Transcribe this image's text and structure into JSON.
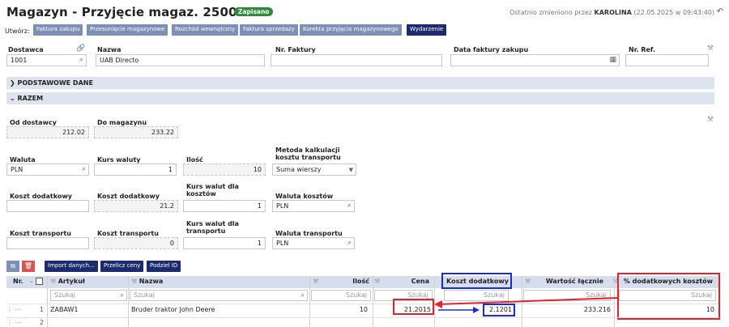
{
  "header": {
    "title": "Magazyn - Przyjęcie magaz. 2500018",
    "status_badge": "Zapisano",
    "last_changed_prefix": "Ostatnio zmieniono przez",
    "last_changed_user": "KAROLINA",
    "last_changed_time": "(22.05.2025 w 09:43:40)"
  },
  "create": {
    "label": "Utwórz:",
    "buttons": [
      "Faktura zakupu",
      "Przesunięcie magazynowe",
      "Rozchód wewnętrzny",
      "Faktura sprzedaży",
      "Korekta przyjęcia magazynowego",
      "Wydarzenie"
    ]
  },
  "top_fields": {
    "dostawca_label": "Dostawca",
    "dostawca_value": "1001",
    "nazwa_label": "Nazwa",
    "nazwa_value": "UAB Directo",
    "nr_faktury_label": "Nr. Faktury",
    "nr_faktury_value": "",
    "data_faktury_label": "Data faktury zakupu",
    "data_faktury_value": "",
    "nr_ref_label": "Nr. Ref.",
    "nr_ref_value": ""
  },
  "sections": {
    "basic": "PODSTAWOWE DANE",
    "total": "RAZEM"
  },
  "totals": {
    "od_dostawcy_label": "Od dostawcy",
    "od_dostawcy_value": "212.02",
    "do_magazynu_label": "Do magazynu",
    "do_magazynu_value": "233.22",
    "waluta_label": "Waluta",
    "waluta_value": "PLN",
    "kurs_waluty_label": "Kurs waluty",
    "kurs_waluty_value": "1",
    "ilosc_label": "Ilość",
    "ilosc_value": "10",
    "metoda_label_1": "Metoda kalkulacji",
    "metoda_label_2": "kosztu transportu",
    "metoda_value": "Suma wierszy",
    "koszt_dod1_label": "Koszt dodatkowy",
    "koszt_dod1_value": "",
    "koszt_dod2_label": "Koszt dodatkowy",
    "koszt_dod2_value": "21.2",
    "kurs_wal_kosztow_label_1": "Kurs walut dla",
    "kurs_wal_kosztow_label_2": "kosztów",
    "kurs_wal_kosztow_value": "1",
    "waluta_kosztow_label": "Waluta kosztów",
    "waluta_kosztow_value": "PLN",
    "koszt_tr1_label": "Koszt transportu",
    "koszt_tr1_value": "",
    "koszt_tr2_label": "Koszt transportu",
    "koszt_tr2_value": "0",
    "kurs_wal_tr_label_1": "Kurs walut dla",
    "kurs_wal_tr_label_2": "transportu",
    "kurs_wal_tr_value": "1",
    "waluta_tr_label": "Waluta transportu",
    "waluta_tr_value": "PLN"
  },
  "toolbar": {
    "import": "Import danych...",
    "recalc": "Przelicz ceny",
    "split": "Podziel ID"
  },
  "table": {
    "headers": {
      "nr": "Nr.",
      "artykul": "Artykuł",
      "nazwa": "Nazwa",
      "ilosc": "Ilość",
      "cena": "Cena",
      "koszt_dodatkowy": "Koszt dodatkowy",
      "wartosc_lacznie": "Wartość łącznie",
      "procent_kosztow": "% dodatkowych kosztów"
    },
    "search_placeholder": "Szukaj",
    "rows": [
      {
        "nr": "1",
        "artykul": "ZABAW1",
        "nazwa": "Bruder traktor John Deere",
        "ilosc": "10",
        "cena": "21.2015",
        "koszt_dodatkowy": "2.1201",
        "wartosc_lacznie": "233.216",
        "procent_kosztow": "10"
      },
      {
        "nr": "2",
        "artykul": "",
        "nazwa": "",
        "ilosc": "",
        "cena": "",
        "koszt_dodatkowy": "",
        "wartosc_lacznie": "",
        "procent_kosztow": ""
      }
    ]
  },
  "colors": {
    "accent": "#1c2a6e",
    "button_light": "#7d8fb6",
    "badge": "#2e8b3e",
    "highlight_red": "#e3222a",
    "highlight_blue": "#1a2bd8"
  }
}
